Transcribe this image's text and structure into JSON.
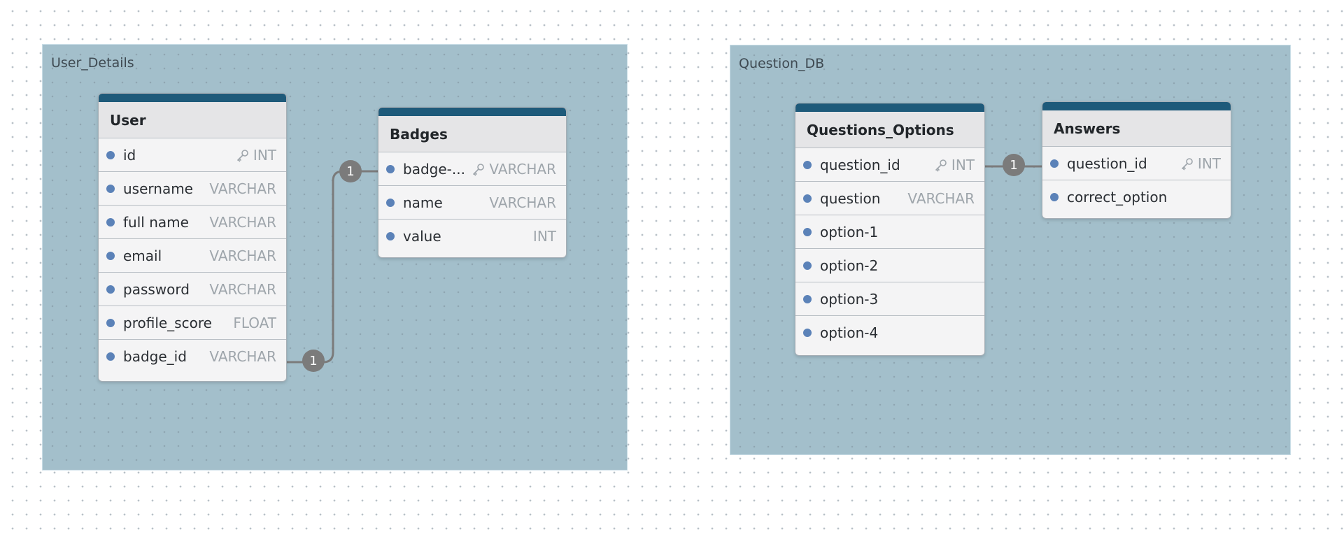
{
  "groups": [
    {
      "label": "User_Details",
      "tables": [
        {
          "name": "User",
          "columns": [
            {
              "field": "id",
              "type": "INT",
              "key": true
            },
            {
              "field": "username",
              "type": "VARCHAR",
              "key": false
            },
            {
              "field": "full name",
              "type": "VARCHAR",
              "key": false
            },
            {
              "field": "email",
              "type": "VARCHAR",
              "key": false
            },
            {
              "field": "password",
              "type": "VARCHAR",
              "key": false
            },
            {
              "field": "profile_score",
              "type": "FLOAT",
              "key": false
            },
            {
              "field": "badge_id",
              "type": "VARCHAR",
              "key": false
            }
          ]
        },
        {
          "name": "Badges",
          "columns": [
            {
              "field": "badge-...",
              "type": "VARCHAR",
              "key": true
            },
            {
              "field": "name",
              "type": "VARCHAR",
              "key": false
            },
            {
              "field": "value",
              "type": "INT",
              "key": false
            }
          ]
        }
      ]
    },
    {
      "label": "Question_DB",
      "tables": [
        {
          "name": "Questions_Options",
          "columns": [
            {
              "field": "question_id",
              "type": "INT",
              "key": true
            },
            {
              "field": "question",
              "type": "VARCHAR",
              "key": false
            },
            {
              "field": "option-1",
              "type": "",
              "key": false
            },
            {
              "field": "option-2",
              "type": "",
              "key": false
            },
            {
              "field": "option-3",
              "type": "",
              "key": false
            },
            {
              "field": "option-4",
              "type": "",
              "key": false
            }
          ]
        },
        {
          "name": "Answers",
          "columns": [
            {
              "field": "question_id",
              "type": "INT",
              "key": true
            },
            {
              "field": "correct_option",
              "type": "",
              "key": false
            }
          ]
        }
      ]
    }
  ],
  "relations": [
    {
      "from": "User.badge_id",
      "to": "Badges.badge-...",
      "from_label": "1",
      "to_label": "1"
    },
    {
      "from": "Questions_Options.question_id",
      "to": "Answers.question_id",
      "label": "1"
    }
  ],
  "colors": {
    "group_fill": "#a3bfcb",
    "table_header_bar": "#1e5a7a",
    "column_dot": "#5b82b8",
    "connector": "#7b7b7b"
  },
  "icons": {
    "primary_key": "key-icon"
  }
}
